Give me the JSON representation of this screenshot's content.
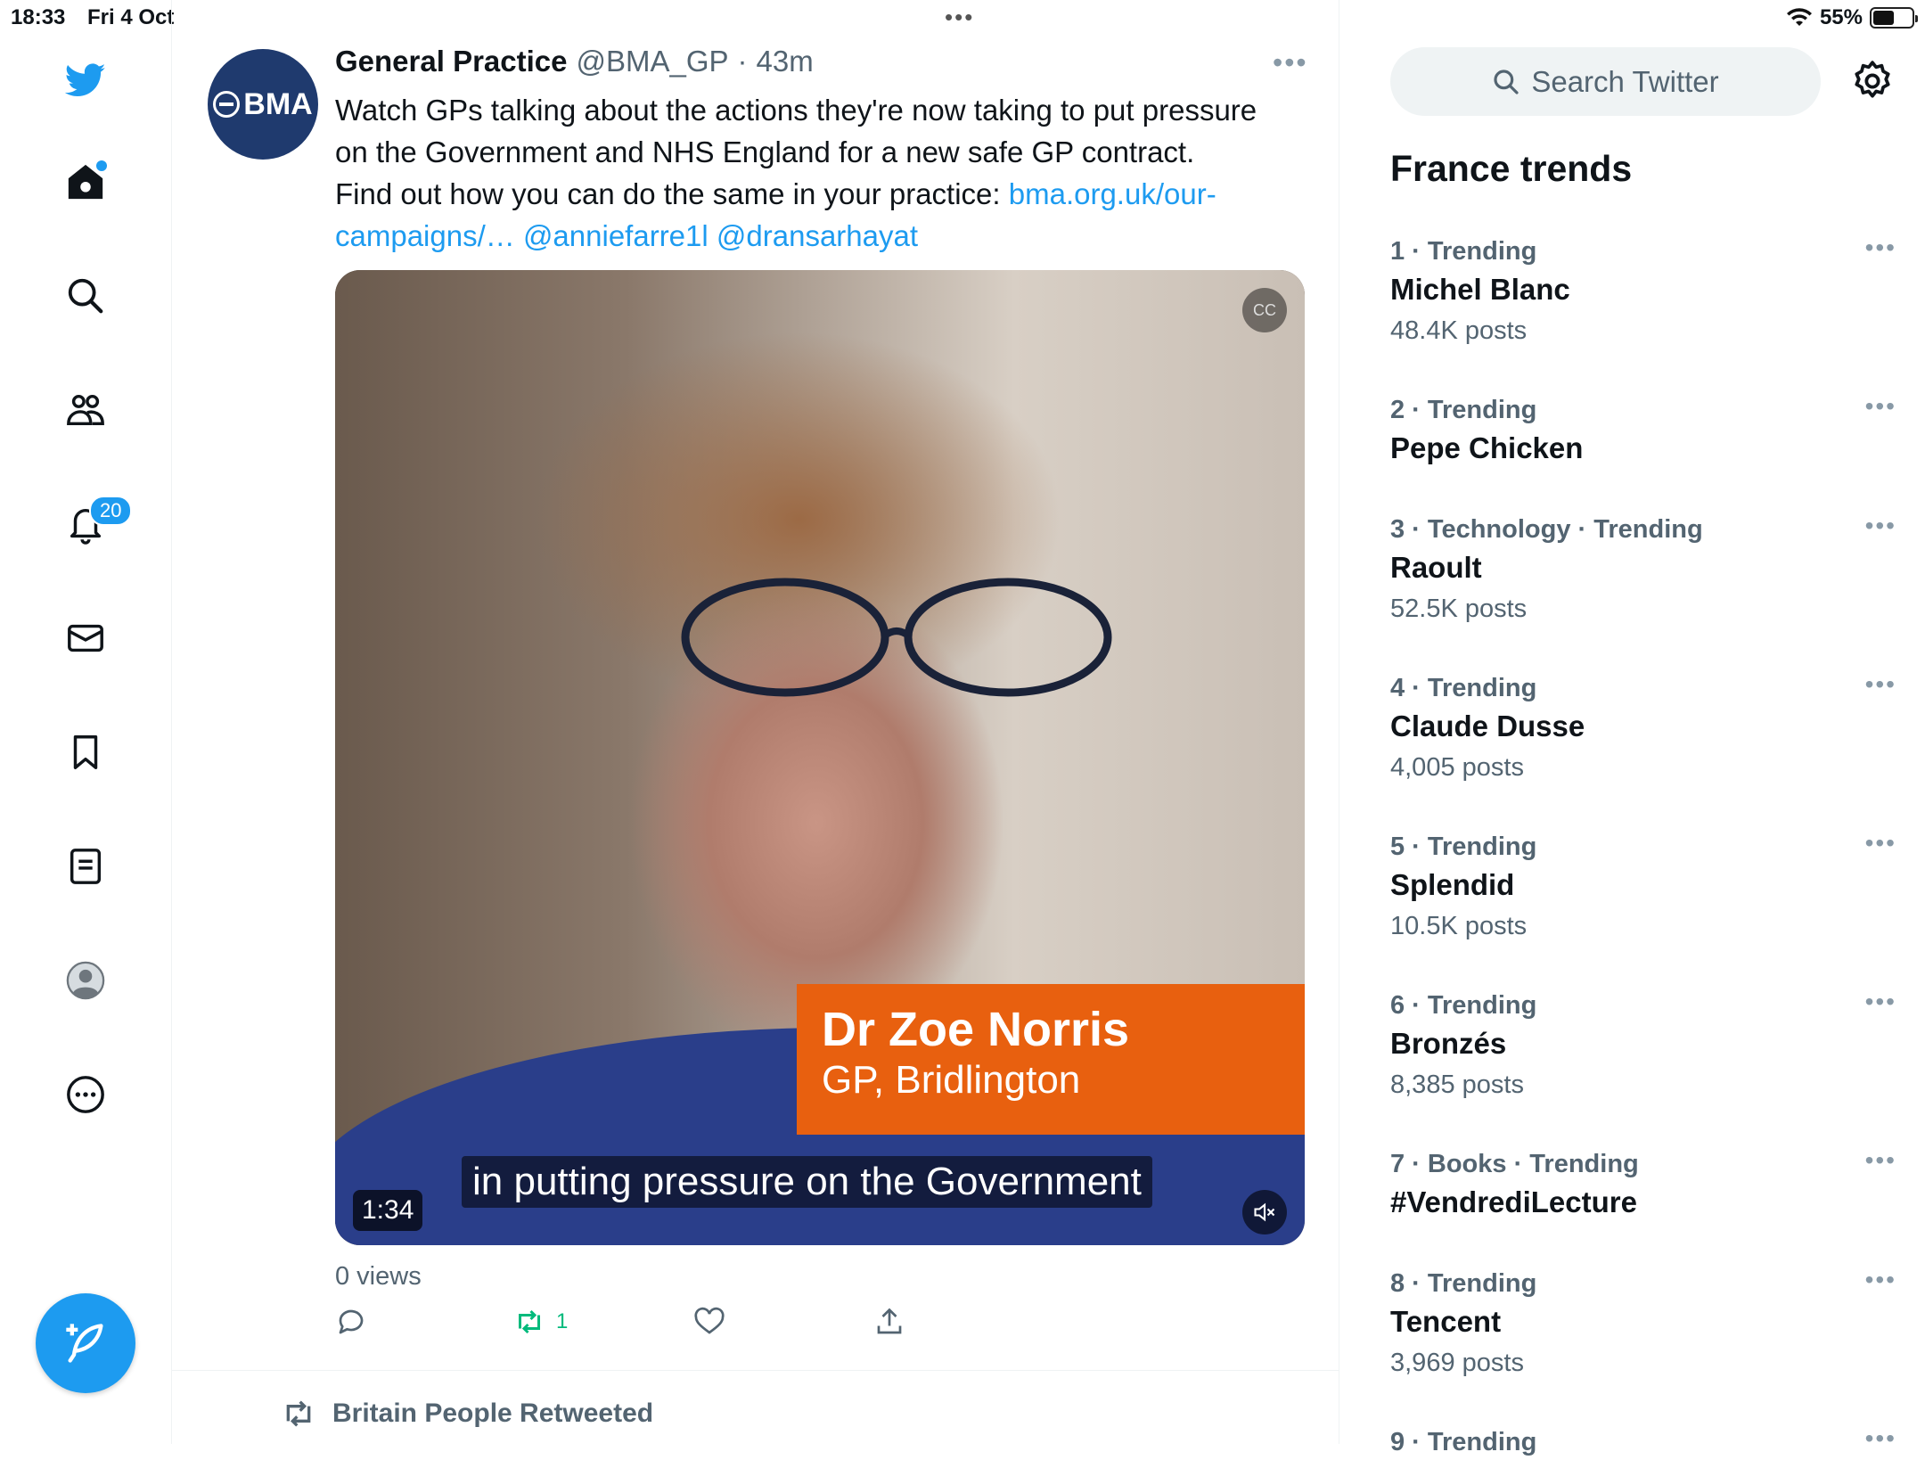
{
  "status_bar": {
    "time": "18:33",
    "date": "Fri 4 Oct",
    "battery": "55%",
    "battery_level": 0.55
  },
  "sidebar": {
    "items": [
      {
        "name": "twitter-logo",
        "icon": "bird"
      },
      {
        "name": "home",
        "icon": "home",
        "badge_dot": true
      },
      {
        "name": "explore",
        "icon": "search"
      },
      {
        "name": "communities",
        "icon": "people"
      },
      {
        "name": "notifications",
        "icon": "bell",
        "badge": "20"
      },
      {
        "name": "messages",
        "icon": "envelope"
      },
      {
        "name": "bookmarks",
        "icon": "bookmark"
      },
      {
        "name": "lists",
        "icon": "list"
      },
      {
        "name": "profile",
        "icon": "avatar"
      },
      {
        "name": "more",
        "icon": "ellipsis-circle"
      }
    ],
    "notification_badge": "20",
    "compose_icon": "feather-plus"
  },
  "tweet": {
    "author_name": "General Practice",
    "handle": "@BMA_GP",
    "separator": "·",
    "time_ago": "43m",
    "avatar_text": "BMA",
    "text_line1": "Watch GPs talking about the actions they're now taking to put pressure",
    "text_line2": "on the Government and NHS England for a new safe GP contract.",
    "text_line3": "Find out how you can do the same in your practice: ",
    "link_part1": "bma.org.uk/our-",
    "link_part2": "campaigns/…",
    "mention1": "@anniefarre1l",
    "mention2": "@dransarhayat",
    "video": {
      "lower_third_name": "Dr Zoe Norris",
      "lower_third_role": "GP, Bridlington",
      "subtitle": "in putting pressure on the Government",
      "duration": "1:34",
      "cc_label": "CC"
    },
    "views": "0 views",
    "retweet_count": "1",
    "colors": {
      "link": "#1d9bf0",
      "retweet_active": "#00ba7c",
      "lower_third": "#e8600f"
    }
  },
  "next_item": {
    "retweeted_by": "Britain People Retweeted"
  },
  "right_column": {
    "search_placeholder": "Search Twitter",
    "trends_title": "France trends",
    "trends": [
      {
        "rank": "1",
        "meta": "1 · Trending",
        "name": "Michel Blanc",
        "count": "48.4K posts"
      },
      {
        "rank": "2",
        "meta": "2 · Trending",
        "name": "Pepe Chicken",
        "count": ""
      },
      {
        "rank": "3",
        "meta": "3 · Technology · Trending",
        "name": "Raoult",
        "count": "52.5K posts"
      },
      {
        "rank": "4",
        "meta": "4 · Trending",
        "name": "Claude Dusse",
        "count": "4,005 posts"
      },
      {
        "rank": "5",
        "meta": "5 · Trending",
        "name": "Splendid",
        "count": "10.5K posts"
      },
      {
        "rank": "6",
        "meta": "6 · Trending",
        "name": "Bronzés",
        "count": "8,385 posts"
      },
      {
        "rank": "7",
        "meta": "7 · Books · Trending",
        "name": "#VendrediLecture",
        "count": ""
      },
      {
        "rank": "8",
        "meta": "8 · Trending",
        "name": "Tencent",
        "count": "3,969 posts"
      },
      {
        "rank": "9",
        "meta": "9 · Trending",
        "name": "",
        "count": ""
      }
    ]
  }
}
